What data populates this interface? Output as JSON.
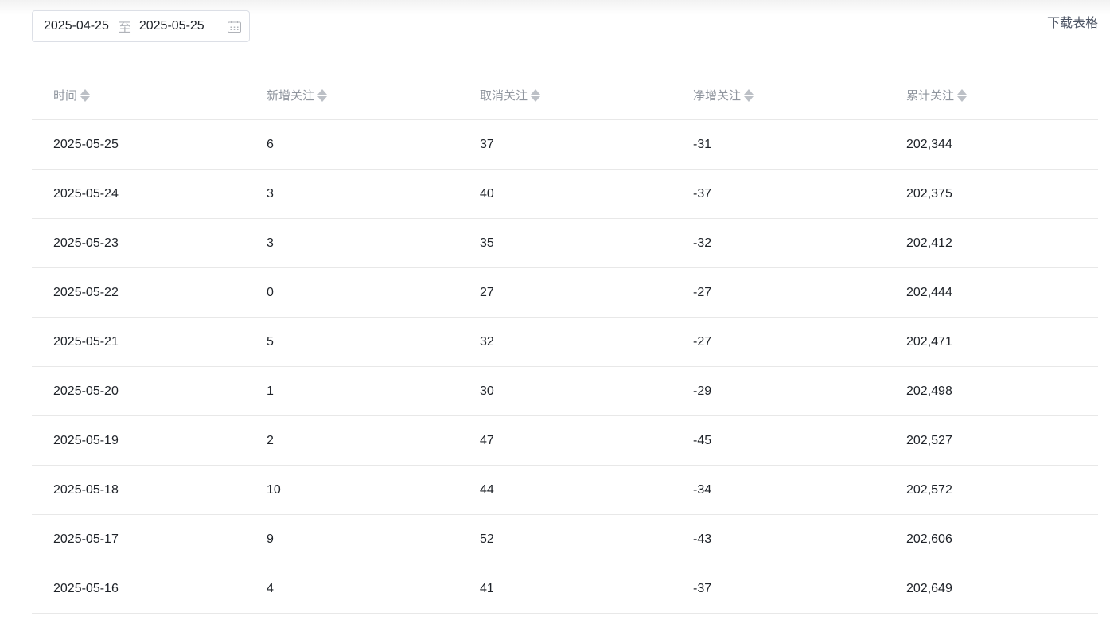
{
  "date_range": {
    "start": "2025-04-25",
    "separator": "至",
    "end": "2025-05-25",
    "icon": "calendar-icon"
  },
  "download_label": "下载表格",
  "table": {
    "headers": [
      "时间",
      "新增关注",
      "取消关注",
      "净增关注",
      "累计关注"
    ],
    "rows": [
      [
        "2025-05-25",
        "6",
        "37",
        "-31",
        "202,344"
      ],
      [
        "2025-05-24",
        "3",
        "40",
        "-37",
        "202,375"
      ],
      [
        "2025-05-23",
        "3",
        "35",
        "-32",
        "202,412"
      ],
      [
        "2025-05-22",
        "0",
        "27",
        "-27",
        "202,444"
      ],
      [
        "2025-05-21",
        "5",
        "32",
        "-27",
        "202,471"
      ],
      [
        "2025-05-20",
        "1",
        "30",
        "-29",
        "202,498"
      ],
      [
        "2025-05-19",
        "2",
        "47",
        "-45",
        "202,527"
      ],
      [
        "2025-05-18",
        "10",
        "44",
        "-34",
        "202,572"
      ],
      [
        "2025-05-17",
        "9",
        "52",
        "-43",
        "202,606"
      ],
      [
        "2025-05-16",
        "4",
        "41",
        "-37",
        "202,649"
      ]
    ]
  },
  "colors": {
    "header_text": "#8f959e",
    "body_text": "#1f2329",
    "divider": "#e8e8e8",
    "sort_icon": "#bcc0c6"
  }
}
